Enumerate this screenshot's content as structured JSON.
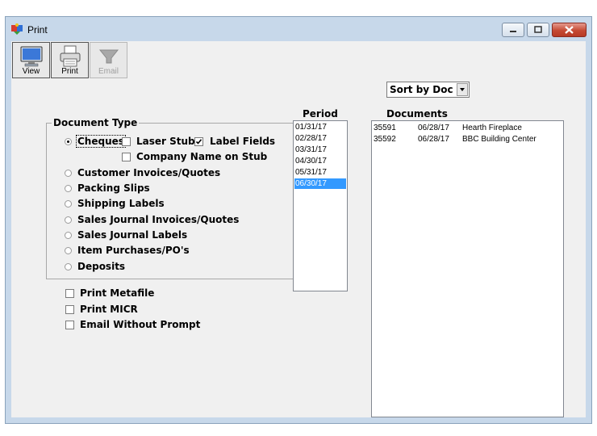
{
  "window": {
    "title": "Print"
  },
  "toolbar": {
    "view_label": "View",
    "print_label": "Print",
    "email_label": "Email"
  },
  "document_type": {
    "legend": "Document Type",
    "selected": "Cheques",
    "options": [
      "Cheques",
      "Customer Invoices/Quotes",
      "Packing Slips",
      "Shipping Labels",
      "Sales Journal Invoices/Quotes",
      "Sales Journal Labels",
      "Item Purchases/PO's",
      "Deposits"
    ],
    "cheque_options": {
      "laser_stub": {
        "label": "Laser Stub",
        "checked": false
      },
      "label_fields": {
        "label": "Label Fields",
        "checked": true
      },
      "company_name_on_stub": {
        "label": "Company Name on Stub",
        "checked": false
      }
    }
  },
  "print_options": [
    {
      "label": "Print Metafile",
      "checked": false
    },
    {
      "label": "Print MICR",
      "checked": false
    },
    {
      "label": "Email Without Prompt",
      "checked": false
    }
  ],
  "period": {
    "header": "Period",
    "items": [
      "01/31/17",
      "02/28/17",
      "03/31/17",
      "04/30/17",
      "05/31/17",
      "06/30/17"
    ],
    "selected": "06/30/17"
  },
  "documents": {
    "header": "Documents",
    "sort_label": "Sort by Doc #",
    "rows": [
      {
        "doc": "35591",
        "date": "06/28/17",
        "name": "Hearth Fireplace"
      },
      {
        "doc": "35592",
        "date": "06/28/17",
        "name": "BBC Building Center"
      }
    ]
  },
  "colors": {
    "selection": "#3399ff",
    "window_frame": "#c7d8ea",
    "close_button": "#c54a34"
  }
}
